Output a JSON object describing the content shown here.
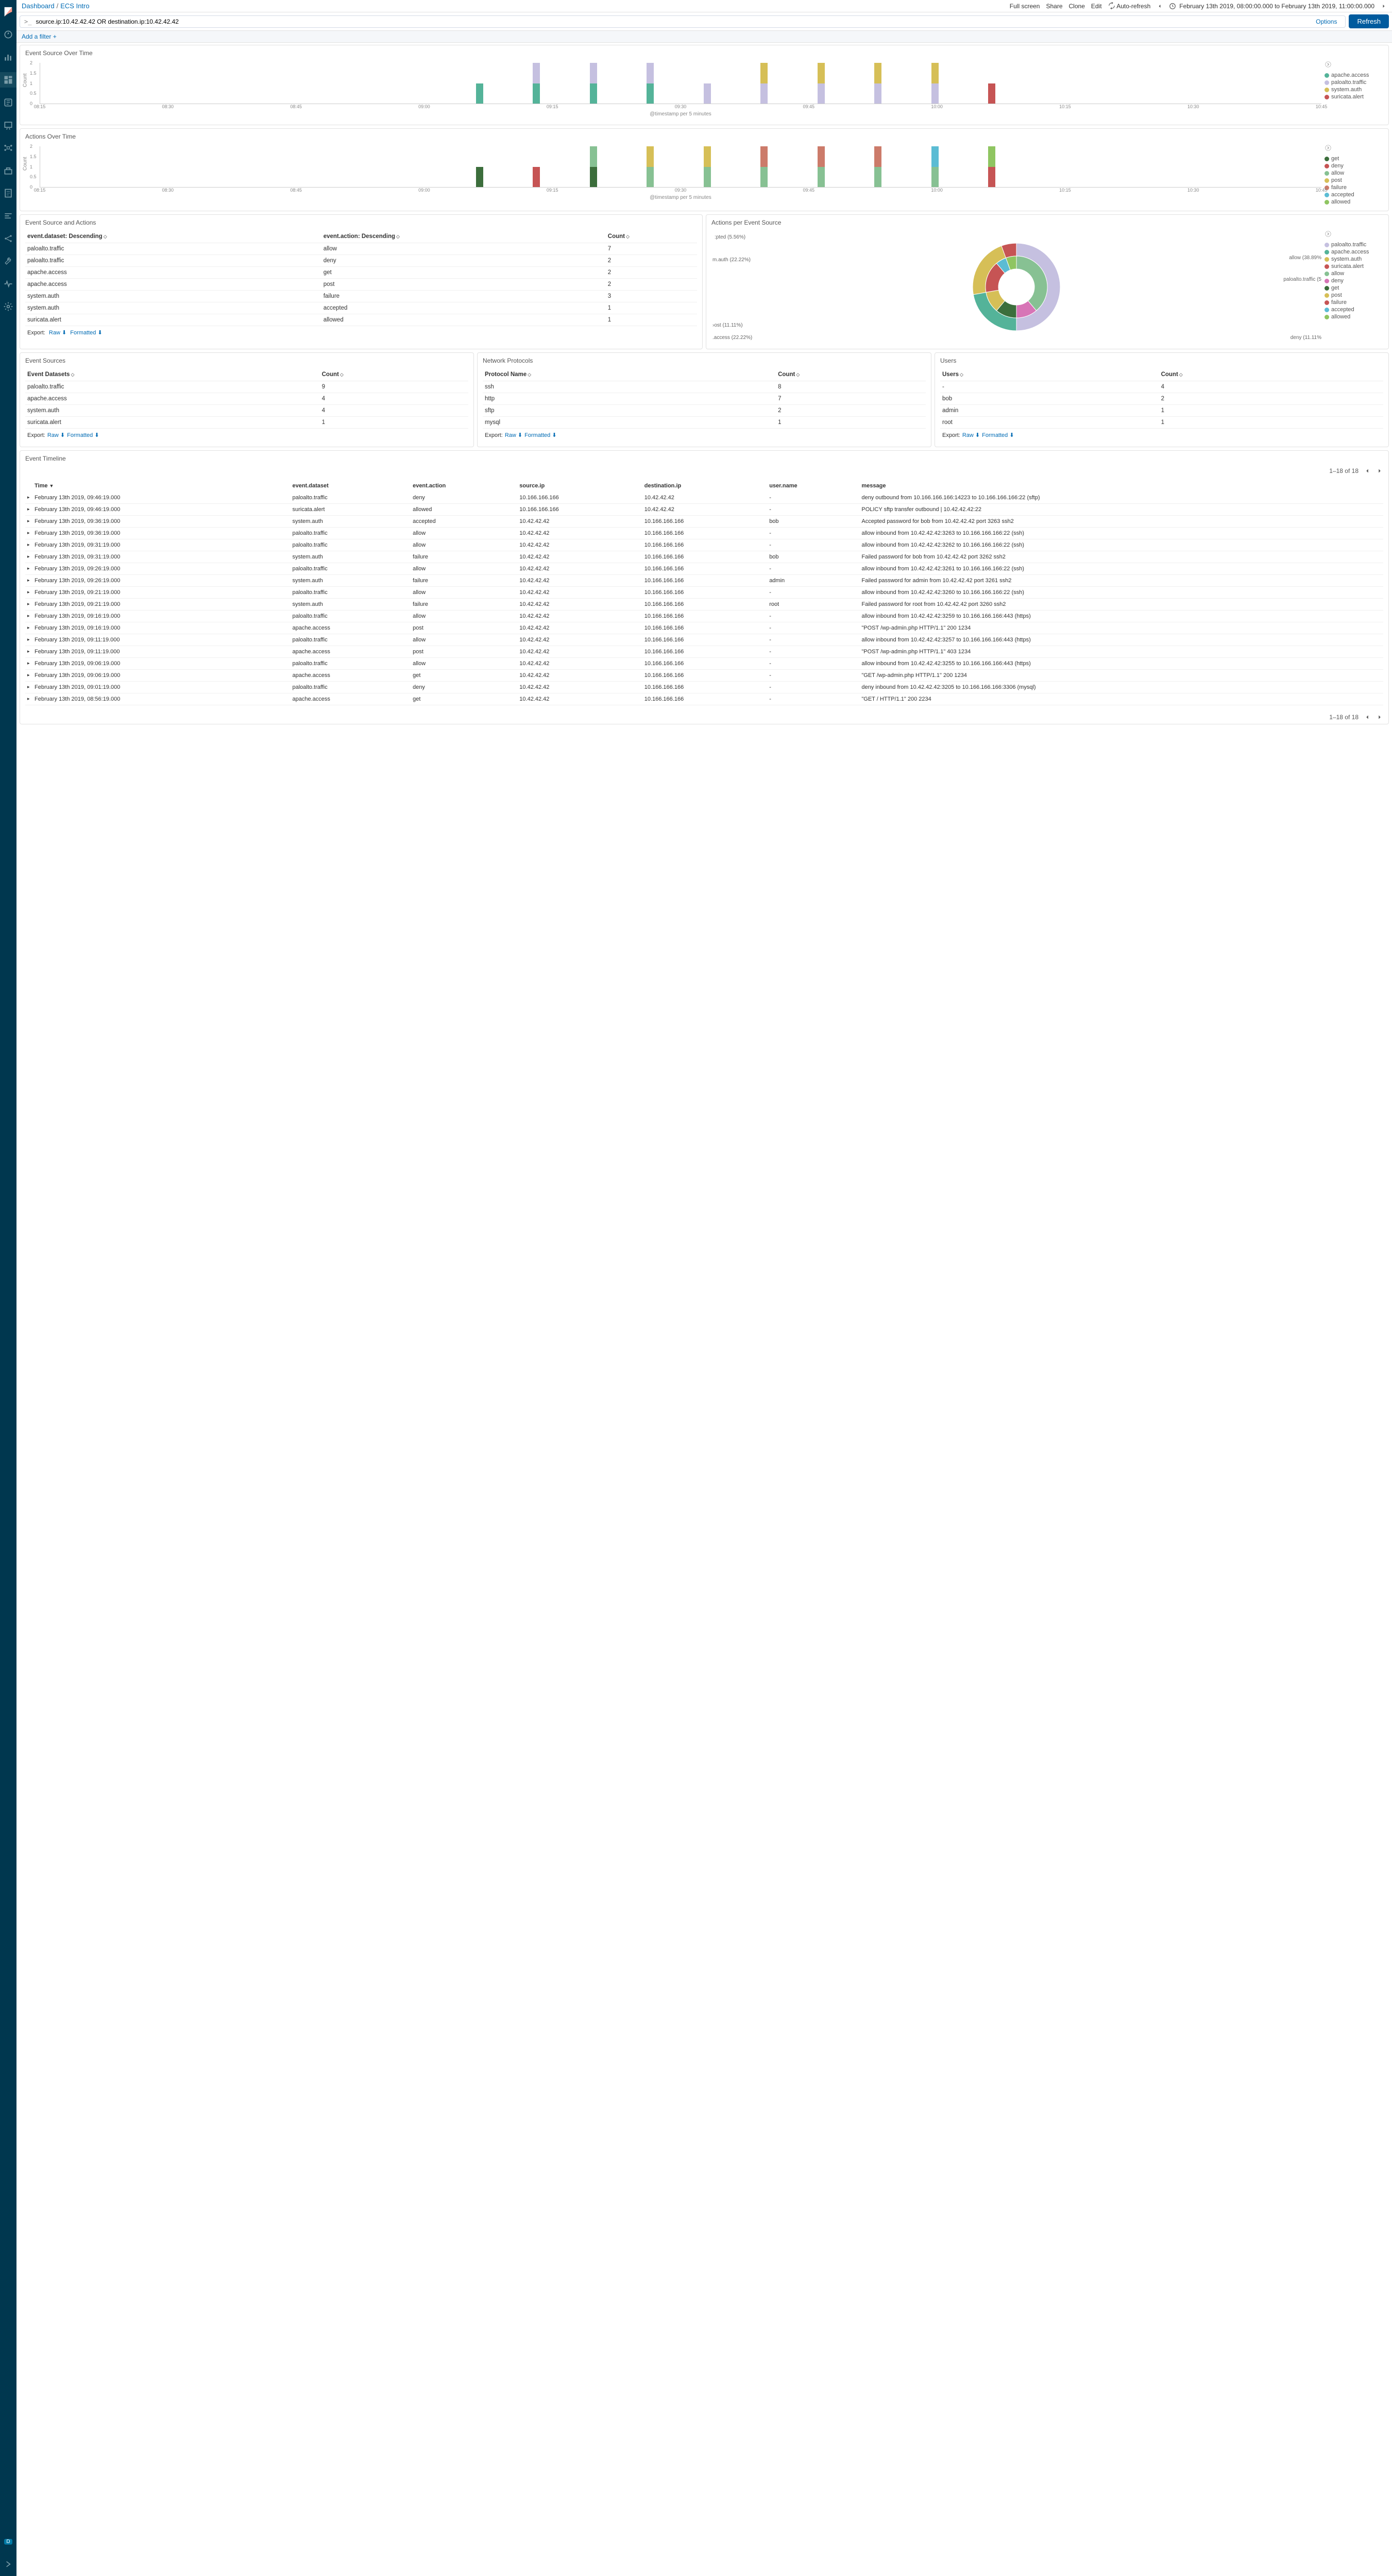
{
  "breadcrumb": {
    "root": "Dashboard",
    "current": "ECS Intro"
  },
  "top_actions": {
    "full_screen": "Full screen",
    "share": "Share",
    "clone": "Clone",
    "edit": "Edit",
    "auto_refresh": "Auto-refresh"
  },
  "time_range": "February 13th 2019, 08:00:00.000 to February 13th 2019, 11:00:00.000",
  "search": {
    "query": "source.ip:10.42.42.42 OR destination.ip:10.42.42.42",
    "options": "Options",
    "refresh": "Refresh"
  },
  "filterbar": {
    "add_filter": "Add a filter"
  },
  "panels": {
    "est": {
      "title": "Event Source Over Time",
      "ylabel": "Count",
      "xlabel": "@timestamp per 5 minutes"
    },
    "aot": {
      "title": "Actions Over Time",
      "ylabel": "Count",
      "xlabel": "@timestamp per 5 minutes"
    },
    "esa": {
      "title": "Event Source and Actions",
      "cols": {
        "c1": "event.dataset: Descending",
        "c2": "event.action: Descending",
        "c3": "Count"
      },
      "rows": [
        {
          "c1": "paloalto.traffic",
          "c2": "allow",
          "c3": "7"
        },
        {
          "c1": "paloalto.traffic",
          "c2": "deny",
          "c3": "2"
        },
        {
          "c1": "apache.access",
          "c2": "get",
          "c3": "2"
        },
        {
          "c1": "apache.access",
          "c2": "post",
          "c3": "2"
        },
        {
          "c1": "system.auth",
          "c2": "failure",
          "c3": "3"
        },
        {
          "c1": "system.auth",
          "c2": "accepted",
          "c3": "1"
        },
        {
          "c1": "suricata.alert",
          "c2": "allowed",
          "c3": "1"
        }
      ]
    },
    "apes": {
      "title": "Actions per Event Source"
    },
    "es": {
      "title": "Event Sources",
      "cols": {
        "c1": "Event Datasets",
        "c2": "Count"
      },
      "rows": [
        {
          "c1": "paloalto.traffic",
          "c2": "9"
        },
        {
          "c1": "apache.access",
          "c2": "4"
        },
        {
          "c1": "system.auth",
          "c2": "4"
        },
        {
          "c1": "suricata.alert",
          "c2": "1"
        }
      ]
    },
    "np": {
      "title": "Network Protocols",
      "cols": {
        "c1": "Protocol Name",
        "c2": "Count"
      },
      "rows": [
        {
          "c1": "ssh",
          "c2": "8"
        },
        {
          "c1": "http",
          "c2": "7"
        },
        {
          "c1": "sftp",
          "c2": "2"
        },
        {
          "c1": "mysql",
          "c2": "1"
        }
      ]
    },
    "usr": {
      "title": "Users",
      "cols": {
        "c1": "Users",
        "c2": "Count"
      },
      "rows": [
        {
          "c1": "-",
          "c2": "4"
        },
        {
          "c1": "bob",
          "c2": "2"
        },
        {
          "c1": "admin",
          "c2": "1"
        },
        {
          "c1": "root",
          "c2": "1"
        }
      ]
    },
    "timeline": {
      "title": "Event Timeline",
      "cols": {
        "time": "Time",
        "ds": "event.dataset",
        "act": "event.action",
        "sip": "source.ip",
        "dip": "destination.ip",
        "user": "user.name",
        "msg": "message"
      },
      "pager": "1–18 of 18",
      "rows": [
        {
          "time": "February 13th 2019, 09:46:19.000",
          "ds": "paloalto.traffic",
          "act": "deny",
          "sip": "10.166.166.166",
          "dip": "10.42.42.42",
          "user": "-",
          "msg": "deny outbound from 10.166.166.166:14223 to 10.166.166.166:22 (sftp)"
        },
        {
          "time": "February 13th 2019, 09:46:19.000",
          "ds": "suricata.alert",
          "act": "allowed",
          "sip": "10.166.166.166",
          "dip": "10.42.42.42",
          "user": "-",
          "msg": "POLICY sftp transfer outbound | 10.42.42.42:22"
        },
        {
          "time": "February 13th 2019, 09:36:19.000",
          "ds": "system.auth",
          "act": "accepted",
          "sip": "10.42.42.42",
          "dip": "10.166.166.166",
          "user": "bob",
          "msg": "Accepted password for bob from 10.42.42.42 port 3263 ssh2"
        },
        {
          "time": "February 13th 2019, 09:36:19.000",
          "ds": "paloalto.traffic",
          "act": "allow",
          "sip": "10.42.42.42",
          "dip": "10.166.166.166",
          "user": "-",
          "msg": "allow inbound from 10.42.42.42:3263 to 10.166.166.166:22 (ssh)"
        },
        {
          "time": "February 13th 2019, 09:31:19.000",
          "ds": "paloalto.traffic",
          "act": "allow",
          "sip": "10.42.42.42",
          "dip": "10.166.166.166",
          "user": "-",
          "msg": "allow inbound from 10.42.42.42:3262 to 10.166.166.166:22 (ssh)"
        },
        {
          "time": "February 13th 2019, 09:31:19.000",
          "ds": "system.auth",
          "act": "failure",
          "sip": "10.42.42.42",
          "dip": "10.166.166.166",
          "user": "bob",
          "msg": "Failed password for bob from 10.42.42.42 port 3262 ssh2"
        },
        {
          "time": "February 13th 2019, 09:26:19.000",
          "ds": "paloalto.traffic",
          "act": "allow",
          "sip": "10.42.42.42",
          "dip": "10.166.166.166",
          "user": "-",
          "msg": "allow inbound from 10.42.42.42:3261 to 10.166.166.166:22 (ssh)"
        },
        {
          "time": "February 13th 2019, 09:26:19.000",
          "ds": "system.auth",
          "act": "failure",
          "sip": "10.42.42.42",
          "dip": "10.166.166.166",
          "user": "admin",
          "msg": "Failed password for admin from 10.42.42.42 port 3261 ssh2"
        },
        {
          "time": "February 13th 2019, 09:21:19.000",
          "ds": "paloalto.traffic",
          "act": "allow",
          "sip": "10.42.42.42",
          "dip": "10.166.166.166",
          "user": "-",
          "msg": "allow inbound from 10.42.42.42:3260 to 10.166.166.166:22 (ssh)"
        },
        {
          "time": "February 13th 2019, 09:21:19.000",
          "ds": "system.auth",
          "act": "failure",
          "sip": "10.42.42.42",
          "dip": "10.166.166.166",
          "user": "root",
          "msg": "Failed password for root from 10.42.42.42 port 3260 ssh2"
        },
        {
          "time": "February 13th 2019, 09:16:19.000",
          "ds": "paloalto.traffic",
          "act": "allow",
          "sip": "10.42.42.42",
          "dip": "10.166.166.166",
          "user": "-",
          "msg": "allow inbound from 10.42.42.42:3259 to 10.166.166.166:443 (https)"
        },
        {
          "time": "February 13th 2019, 09:16:19.000",
          "ds": "apache.access",
          "act": "post",
          "sip": "10.42.42.42",
          "dip": "10.166.166.166",
          "user": "-",
          "msg": "\"POST /wp-admin.php HTTP/1.1\" 200 1234"
        },
        {
          "time": "February 13th 2019, 09:11:19.000",
          "ds": "paloalto.traffic",
          "act": "allow",
          "sip": "10.42.42.42",
          "dip": "10.166.166.166",
          "user": "-",
          "msg": "allow inbound from 10.42.42.42:3257 to 10.166.166.166:443 (https)"
        },
        {
          "time": "February 13th 2019, 09:11:19.000",
          "ds": "apache.access",
          "act": "post",
          "sip": "10.42.42.42",
          "dip": "10.166.166.166",
          "user": "-",
          "msg": "\"POST /wp-admin.php HTTP/1.1\" 403 1234"
        },
        {
          "time": "February 13th 2019, 09:06:19.000",
          "ds": "paloalto.traffic",
          "act": "allow",
          "sip": "10.42.42.42",
          "dip": "10.166.166.166",
          "user": "-",
          "msg": "allow inbound from 10.42.42.42:3255 to 10.166.166.166:443 (https)"
        },
        {
          "time": "February 13th 2019, 09:06:19.000",
          "ds": "apache.access",
          "act": "get",
          "sip": "10.42.42.42",
          "dip": "10.166.166.166",
          "user": "-",
          "msg": "\"GET /wp-admin.php HTTP/1.1\" 200 1234"
        },
        {
          "time": "February 13th 2019, 09:01:19.000",
          "ds": "paloalto.traffic",
          "act": "deny",
          "sip": "10.42.42.42",
          "dip": "10.166.166.166",
          "user": "-",
          "msg": "deny inbound from 10.42.42.42:3205 to 10.166.166.166:3306 (mysql)"
        },
        {
          "time": "February 13th 2019, 08:56:19.000",
          "ds": "apache.access",
          "act": "get",
          "sip": "10.42.42.42",
          "dip": "10.166.166.166",
          "user": "-",
          "msg": "\"GET / HTTP/1.1\" 200 2234"
        }
      ]
    }
  },
  "export": {
    "label": "Export:",
    "raw": "Raw",
    "formatted": "Formatted"
  },
  "legend": {
    "est": [
      {
        "name": "apache.access",
        "color": "#54b399"
      },
      {
        "name": "paloalto.traffic",
        "color": "#c5c0e0"
      },
      {
        "name": "system.auth",
        "color": "#d6bf57"
      },
      {
        "name": "suricata.alert",
        "color": "#c65454"
      }
    ],
    "aot": [
      {
        "name": "get",
        "color": "#3c6e3c"
      },
      {
        "name": "deny",
        "color": "#c65454"
      },
      {
        "name": "allow",
        "color": "#87c193"
      },
      {
        "name": "post",
        "color": "#d6bf57"
      },
      {
        "name": "failure",
        "color": "#cc7b6a"
      },
      {
        "name": "accepted",
        "color": "#5bbcd4"
      },
      {
        "name": "allowed",
        "color": "#8fc561"
      }
    ],
    "apes_outer": [
      {
        "name": "paloalto.traffic",
        "color": "#c5c0e0"
      },
      {
        "name": "apache.access",
        "color": "#54b399"
      },
      {
        "name": "system.auth",
        "color": "#d6bf57"
      },
      {
        "name": "suricata.alert",
        "color": "#c65454"
      }
    ],
    "apes_inner": [
      {
        "name": "allow",
        "color": "#87c193"
      },
      {
        "name": "deny",
        "color": "#d775b6"
      },
      {
        "name": "get",
        "color": "#3c6e3c"
      },
      {
        "name": "post",
        "color": "#d6bf57"
      },
      {
        "name": "failure",
        "color": "#c65454"
      },
      {
        "name": "accepted",
        "color": "#5bbcd4"
      },
      {
        "name": "allowed",
        "color": "#8fc561"
      }
    ]
  },
  "donut_labels": {
    "l1": ":pted (5.56%)",
    "l2": "m.auth (22.22%)",
    "l3": "›ost (11.11%)",
    "l4": ".access (22.22%)",
    "l5": "allow (38.89%",
    "l6": "paloalto.traffic (5",
    "l7": "deny (11.11%"
  },
  "chart_data": {
    "est": {
      "type": "bar",
      "xlabel": "@timestamp per 5 minutes",
      "ylabel": "Count",
      "ylim": [
        0,
        2
      ],
      "x_ticks": [
        "08:15",
        "08:30",
        "08:45",
        "09:00",
        "09:15",
        "09:30",
        "09:45",
        "10:00",
        "10:15",
        "10:30",
        "10:45"
      ],
      "categories": [
        "08:55",
        "09:00",
        "09:05",
        "09:10",
        "09:15",
        "09:20",
        "09:25",
        "09:30",
        "09:35",
        "09:45"
      ],
      "series": [
        {
          "name": "apache.access",
          "color": "#54b399",
          "values": [
            1,
            1,
            1,
            1,
            0,
            0,
            0,
            0,
            0,
            0
          ]
        },
        {
          "name": "paloalto.traffic",
          "color": "#c5c0e0",
          "values": [
            0,
            1,
            1,
            1,
            1,
            1,
            1,
            1,
            1,
            0
          ]
        },
        {
          "name": "system.auth",
          "color": "#d6bf57",
          "values": [
            0,
            0,
            0,
            0,
            0,
            1,
            1,
            1,
            1,
            0
          ]
        },
        {
          "name": "suricata.alert",
          "color": "#c65454",
          "values": [
            0,
            0,
            0,
            0,
            0,
            0,
            0,
            0,
            0,
            1
          ]
        }
      ]
    },
    "aot": {
      "type": "bar",
      "xlabel": "@timestamp per 5 minutes",
      "ylabel": "Count",
      "ylim": [
        0,
        2
      ],
      "x_ticks": [
        "08:15",
        "08:30",
        "08:45",
        "09:00",
        "09:15",
        "09:30",
        "09:45",
        "10:00",
        "10:15",
        "10:30",
        "10:45"
      ],
      "categories": [
        "08:55",
        "09:00",
        "09:05",
        "09:10",
        "09:15",
        "09:20",
        "09:25",
        "09:30",
        "09:35",
        "09:45"
      ],
      "series": [
        {
          "name": "get",
          "color": "#3c6e3c",
          "values": [
            1,
            0,
            1,
            0,
            0,
            0,
            0,
            0,
            0,
            0
          ]
        },
        {
          "name": "deny",
          "color": "#c65454",
          "values": [
            0,
            1,
            0,
            0,
            0,
            0,
            0,
            0,
            0,
            1
          ]
        },
        {
          "name": "allow",
          "color": "#87c193",
          "values": [
            0,
            0,
            1,
            1,
            1,
            1,
            1,
            1,
            1,
            0
          ]
        },
        {
          "name": "post",
          "color": "#d6bf57",
          "values": [
            0,
            0,
            0,
            1,
            1,
            0,
            0,
            0,
            0,
            0
          ]
        },
        {
          "name": "failure",
          "color": "#cc7b6a",
          "values": [
            0,
            0,
            0,
            0,
            0,
            1,
            1,
            1,
            0,
            0
          ]
        },
        {
          "name": "accepted",
          "color": "#5bbcd4",
          "values": [
            0,
            0,
            0,
            0,
            0,
            0,
            0,
            0,
            1,
            0
          ]
        },
        {
          "name": "allowed",
          "color": "#8fc561",
          "values": [
            0,
            0,
            0,
            0,
            0,
            0,
            0,
            0,
            0,
            1
          ]
        }
      ]
    },
    "apes": {
      "type": "pie",
      "outer": {
        "series": "event.dataset",
        "slices": [
          {
            "name": "paloalto.traffic",
            "value": 50.0,
            "color": "#c5c0e0"
          },
          {
            "name": "apache.access",
            "value": 22.22,
            "color": "#54b399"
          },
          {
            "name": "system.auth",
            "value": 22.22,
            "color": "#d6bf57"
          },
          {
            "name": "suricata.alert",
            "value": 5.56,
            "color": "#c65454"
          }
        ]
      },
      "inner": {
        "series": "event.action",
        "slices": [
          {
            "name": "allow",
            "value": 38.89,
            "color": "#87c193"
          },
          {
            "name": "deny",
            "value": 11.11,
            "color": "#d775b6"
          },
          {
            "name": "get",
            "value": 11.11,
            "color": "#3c6e3c"
          },
          {
            "name": "post",
            "value": 11.11,
            "color": "#d6bf57"
          },
          {
            "name": "failure",
            "value": 16.67,
            "color": "#c65454"
          },
          {
            "name": "accepted",
            "value": 5.56,
            "color": "#5bbcd4"
          },
          {
            "name": "allowed",
            "value": 5.56,
            "color": "#8fc561"
          }
        ]
      }
    }
  }
}
